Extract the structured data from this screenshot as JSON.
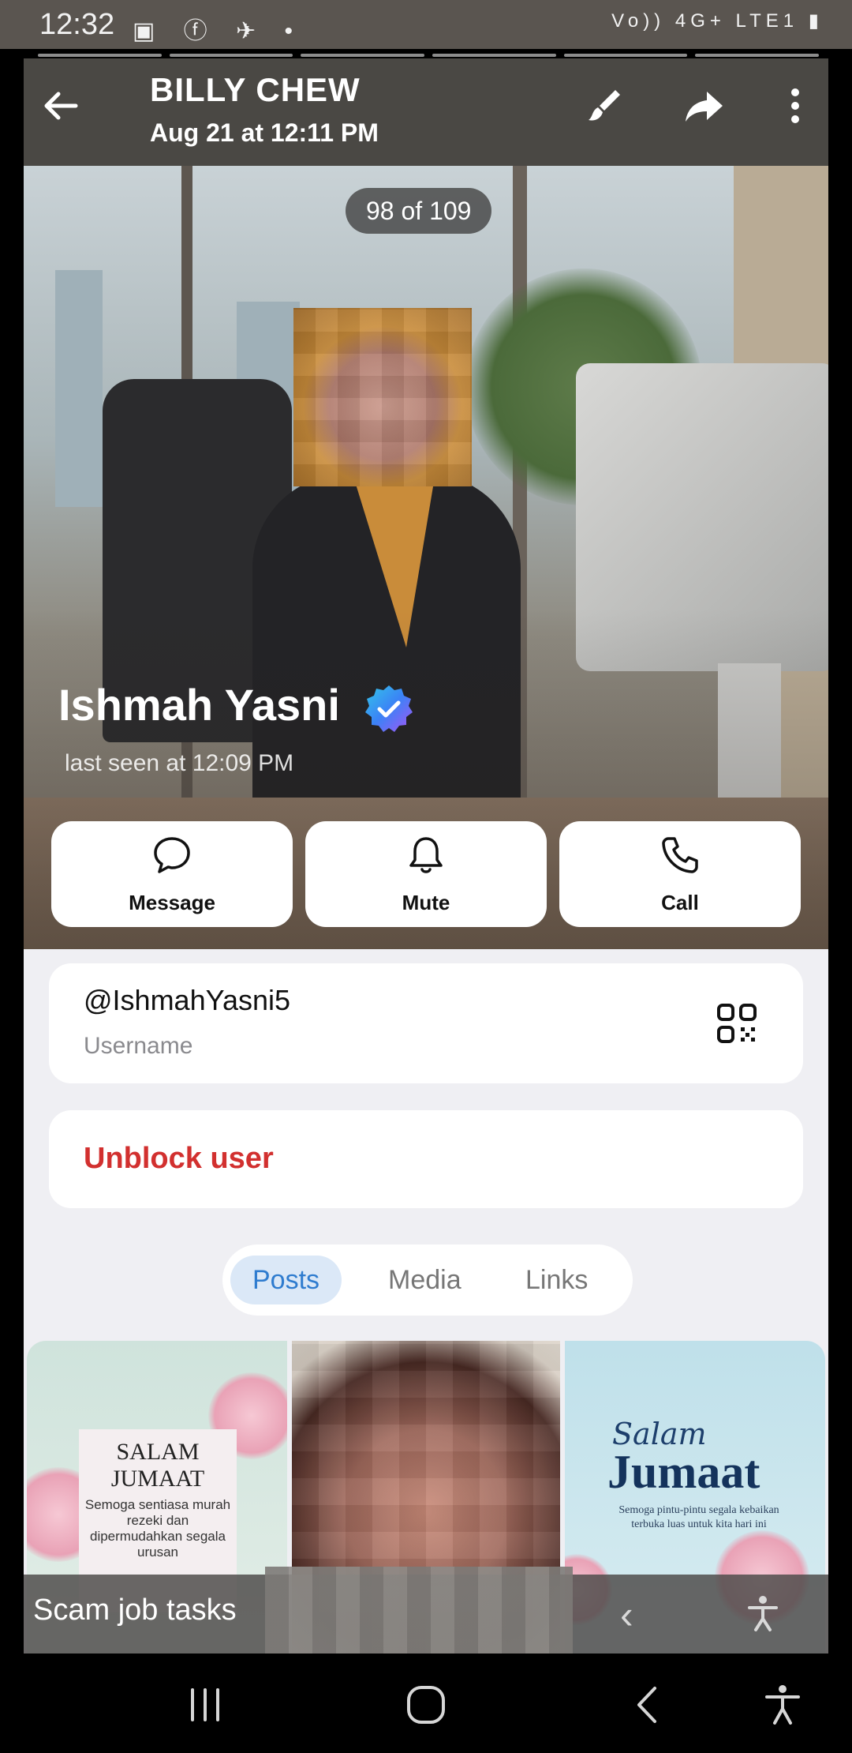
{
  "status_bar": {
    "time": "12:32",
    "left_icons": "▣ ⓕ ✈ •",
    "right_text": "Vo)) 4G+ LTE1 ▮"
  },
  "viewer": {
    "title": "BILLY CHEW",
    "subtitle": "Aug 21 at 12:11 PM",
    "counter": "98 of 109",
    "icons": [
      "back-arrow-icon",
      "brush-icon",
      "forward-icon",
      "more-vertical-icon"
    ]
  },
  "profile": {
    "name": "Ishmah Yasni",
    "status": "last seen at 12:09 PM",
    "verified_color": "#3b82f6",
    "actions": [
      {
        "label": "Message",
        "icon": "chat-bubble-icon"
      },
      {
        "label": "Mute",
        "icon": "bell-icon"
      },
      {
        "label": "Call",
        "icon": "phone-icon"
      }
    ]
  },
  "info": {
    "username": "@IshmahYasni5",
    "username_caption": "Username",
    "unblock": "Unblock user",
    "unblock_color": "#d2302f"
  },
  "tabs": [
    {
      "label": "Posts",
      "active": true
    },
    {
      "label": "Media",
      "active": false
    },
    {
      "label": "Links",
      "active": false
    }
  ],
  "posts": {
    "card1_title": "SALAM JUMAAT",
    "card1_body": "Semoga sentiasa murah rezeki dan dipermudahkan segala urusan",
    "card3_script": "Salam",
    "card3_title": "Jumaat",
    "card3_body": "Semoga pintu-pintu segala kebaikan terbuka luas untuk kita hari ini"
  },
  "caption": {
    "text": "Scam job tasks"
  },
  "nav": [
    "recent-apps-icon",
    "home-icon",
    "back-icon",
    "accessibility-icon"
  ]
}
